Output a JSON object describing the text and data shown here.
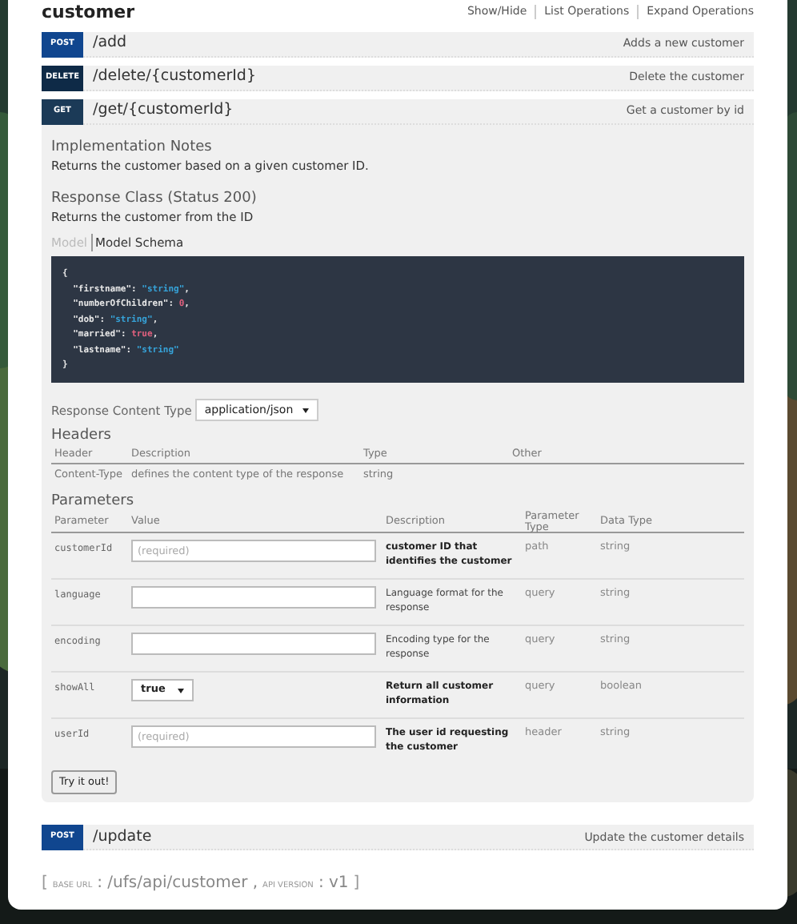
{
  "resource": {
    "name": "customer",
    "links": [
      "Show/Hide",
      "List Operations",
      "Expand Operations"
    ]
  },
  "operations": [
    {
      "method": "POST",
      "path": "/add",
      "summary": "Adds a new customer"
    },
    {
      "method": "DELETE",
      "path": "/delete/{customerId}",
      "summary": "Delete the customer"
    },
    {
      "method": "GET",
      "path": "/get/{customerId}",
      "summary": "Get a customer by id",
      "details": {
        "notes_title": "Implementation Notes",
        "notes": "Returns the customer based on a given customer ID.",
        "response_title": "Response Class (Status 200)",
        "response_text": "Returns the customer from the ID",
        "model_tabs": [
          {
            "label": "Model",
            "selected": false
          },
          {
            "label": "Model Schema",
            "selected": true
          }
        ],
        "code_lines": [
          [
            {
              "t": "{",
              "kind": "punct"
            }
          ],
          [
            {
              "t": "  \"firstname\"",
              "kind": "key"
            },
            {
              "t": ": ",
              "kind": "punct"
            },
            {
              "t": "\"string\"",
              "kind": "string"
            },
            {
              "t": ",",
              "kind": "punct"
            }
          ],
          [
            {
              "t": "  \"numberOfChildren\"",
              "kind": "key"
            },
            {
              "t": ": ",
              "kind": "punct"
            },
            {
              "t": "0",
              "kind": "literal"
            },
            {
              "t": ",",
              "kind": "punct"
            }
          ],
          [
            {
              "t": "  \"dob\"",
              "kind": "key"
            },
            {
              "t": ": ",
              "kind": "punct"
            },
            {
              "t": "\"string\"",
              "kind": "string"
            },
            {
              "t": ",",
              "kind": "punct"
            }
          ],
          [
            {
              "t": "  \"married\"",
              "kind": "key"
            },
            {
              "t": ": ",
              "kind": "punct"
            },
            {
              "t": "true",
              "kind": "literal"
            },
            {
              "t": ",",
              "kind": "punct"
            }
          ],
          [
            {
              "t": "  \"lastname\"",
              "kind": "key"
            },
            {
              "t": ": ",
              "kind": "punct"
            },
            {
              "t": "\"string\"",
              "kind": "string"
            }
          ],
          [
            {
              "t": "}",
              "kind": "punct"
            }
          ]
        ],
        "content_type_label": "Response Content Type",
        "content_type": "application/json",
        "headers_title": "Headers",
        "headers_columns": [
          "Header",
          "Description",
          "Type",
          "Other"
        ],
        "headers_rows": [
          [
            "Content-Type",
            "defines the content type of the response",
            "string",
            ""
          ]
        ],
        "params_title": "Parameters",
        "params_columns": [
          "Parameter",
          "Value",
          "Description",
          "Parameter Type",
          "Data Type"
        ],
        "params": [
          {
            "name": "customerId",
            "kind": "input",
            "placeholder": "(required)",
            "description": "customer ID that identifies the customer",
            "required": true,
            "param_type": "path",
            "data_type": "string"
          },
          {
            "name": "language",
            "kind": "input",
            "description": "Language format for the response",
            "required": false,
            "param_type": "query",
            "data_type": "string"
          },
          {
            "name": "encoding",
            "kind": "input",
            "description": "Encoding type for the response",
            "required": false,
            "param_type": "query",
            "data_type": "string"
          },
          {
            "name": "showAll",
            "kind": "select",
            "value": "true",
            "description": "Return all customer information",
            "required": true,
            "param_type": "query",
            "data_type": "boolean"
          },
          {
            "name": "userId",
            "kind": "input",
            "placeholder": "(required)",
            "description": "The user id requesting the customer",
            "required": true,
            "param_type": "header",
            "data_type": "string"
          }
        ],
        "try_button": "Try it out!"
      }
    },
    {
      "method": "POST",
      "path": "/update",
      "summary": "Update the customer details"
    }
  ],
  "footer": {
    "open": "[",
    "base_url_label": "BASE URL",
    "base_url": ": /ufs/api/customer ,",
    "api_version_label": "API VERSION",
    "api_version": ": v1",
    "close": "]"
  }
}
